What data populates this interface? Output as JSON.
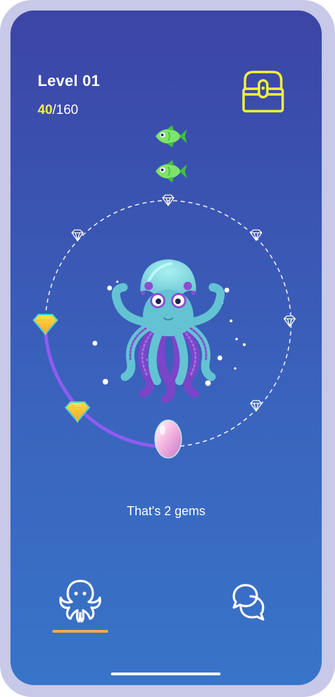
{
  "header": {
    "level_label": "Level 01",
    "progress_current": "40",
    "progress_total": "/160"
  },
  "icons": {
    "chest": "treasure-chest-icon",
    "fish": "fish-icon",
    "gem": "diamond-icon",
    "egg": "egg-icon",
    "octopus": "octopus-icon",
    "chat": "chat-bubbles-icon"
  },
  "ring": {
    "collected_gems": 2,
    "total_gem_slots": 7
  },
  "caption": "That's 2 gems",
  "nav": {
    "active_tab": "octopus",
    "tabs": [
      "octopus",
      "chat"
    ]
  },
  "colors": {
    "background_top": "#3b45a6",
    "background_bottom": "#3874c8",
    "accent_yellow": "#f2f23a",
    "progress_arc": "#8e5cf0",
    "nav_underline": "#f2a953"
  }
}
